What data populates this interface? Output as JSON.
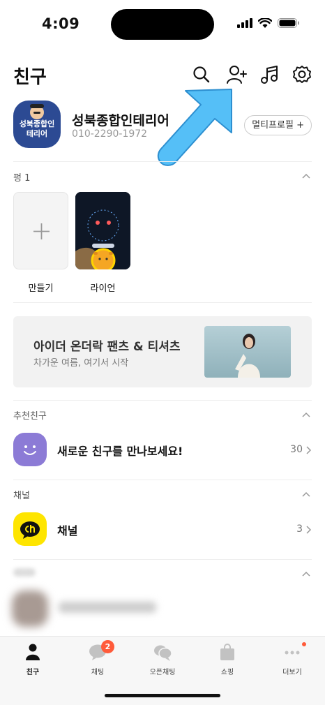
{
  "status_bar": {
    "time": "4:09"
  },
  "header": {
    "title": "친구",
    "icons": [
      "search-icon",
      "add-friend-icon",
      "music-icon",
      "settings-icon"
    ]
  },
  "profile": {
    "avatar_text": "성북종합인테리어",
    "name": "성북종합인테리어",
    "phone": "010-2290-1972",
    "multi_profile_label": "멀티프로필 +"
  },
  "stories_section": {
    "title": "펑 1",
    "items": [
      {
        "label": "만들기"
      },
      {
        "label": "라이언"
      }
    ]
  },
  "banner": {
    "title": "아이더 온더락 팬츠 & 티셔츠",
    "subtitle": "차가운 여름, 여기서 시작"
  },
  "recommend_section": {
    "title": "추천친구",
    "label": "새로운 친구를 만나보세요!",
    "count": "30"
  },
  "channel_section": {
    "title": "채널",
    "label": "채널",
    "count": "3"
  },
  "tabbar": {
    "tabs": [
      {
        "label": "친구",
        "icon": "person-icon",
        "active": true
      },
      {
        "label": "채팅",
        "icon": "chat-bubble-icon",
        "badge": "2"
      },
      {
        "label": "오픈채팅",
        "icon": "open-chat-icon"
      },
      {
        "label": "쇼핑",
        "icon": "shopping-bag-icon"
      },
      {
        "label": "더보기",
        "icon": "more-dots-icon"
      }
    ]
  },
  "colors": {
    "accent_yellow": "#FEE500",
    "badge_red": "#FF5B3A",
    "arrow_blue": "#4DB8F5",
    "recommend_purple": "#8C7BD6"
  }
}
